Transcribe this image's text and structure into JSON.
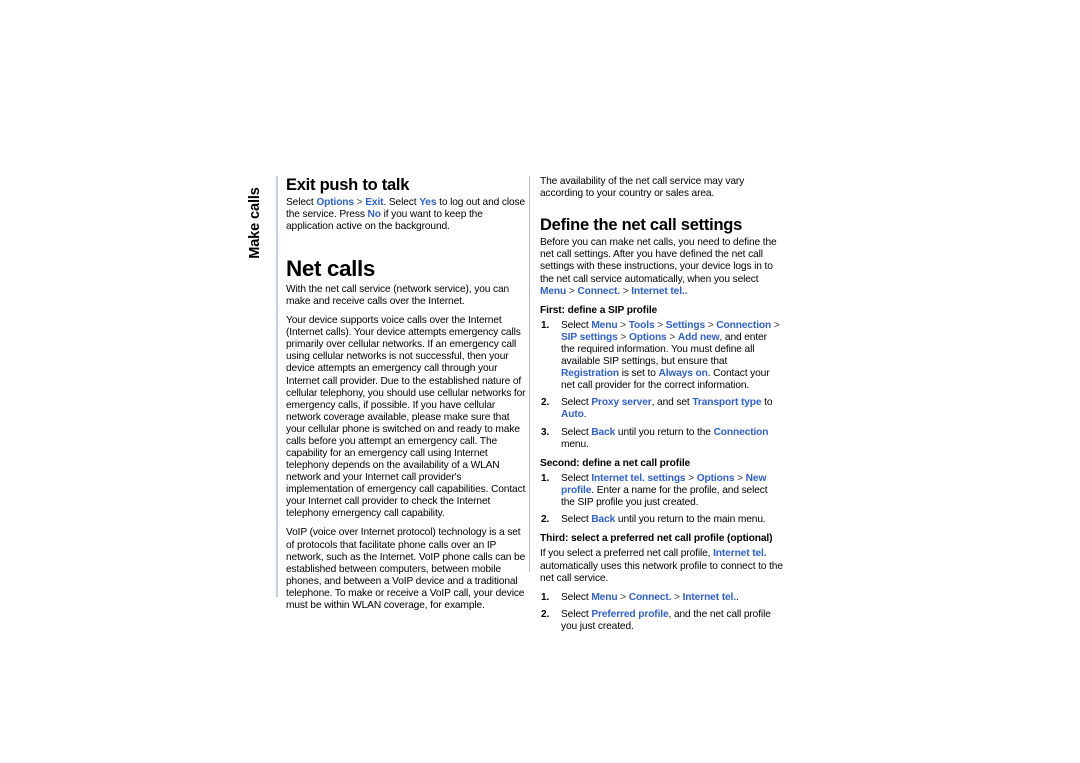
{
  "page": {
    "side_tab_label": "Make calls",
    "link_color": "#2f5fd0",
    "rule_color": "#c3cfe3"
  },
  "left_column": {
    "section_exit": {
      "heading": "Exit push to talk",
      "body_1_a": "Select ",
      "body_1_opt": "Options",
      "body_1_b": " > ",
      "body_1_exit": "Exit",
      "body_1_c": ". Select ",
      "body_1_yes": "Yes",
      "body_1_d": " to log out and close the service. Press ",
      "body_1_no": "No",
      "body_1_e": " if you want to keep the application active on the background."
    },
    "section_net_calls": {
      "heading": "Net calls",
      "para_1": "With the net call service (network service), you can make and receive calls over the Internet.",
      "para_2": "Your device supports voice calls over the Internet (Internet calls). Your device attempts emergency calls primarily over cellular networks. If an emergency call using cellular networks is not successful, then your device attempts an emergency call through your Internet call provider. Due to the established nature of cellular telephony, you should use cellular networks for emergency calls, if possible. If you have cellular network coverage available, please make sure that your cellular phone is switched on and ready to make calls before you attempt an emergency call. The capability for an emergency call using Internet telephony depends on the availability of a WLAN network and your Internet call provider's implementation of emergency call capabilities. Contact your Internet call provider to check the Internet telephony emergency call capability.",
      "para_3": "VoIP (voice over Internet protocol) technology is a set of protocols that facilitate phone calls over an IP network, such as the Internet. VoIP phone calls can be established between computers, between mobile phones, and between a VoIP device and a traditional telephone. To make or receive a VoIP call, your device must be within WLAN coverage, for example."
    }
  },
  "right_column": {
    "intro": "The availability of the net call service may vary according to your country or sales area.",
    "section_define": {
      "heading": "Define the net call settings",
      "para_1_a": "Before you can make net calls, you need to define the net call settings. After you have defined the net call settings with these instructions, your device logs in to the net call service automatically, when you select ",
      "para_1_menu": "Menu",
      "para_1_gt1": " > ",
      "para_1_connect": "Connect.",
      "para_1_gt2": " > ",
      "para_1_inettel": "Internet tel.",
      "para_1_end": ".",
      "sub_first": "First: define a SIP profile",
      "first_items": [
        {
          "num": "1.",
          "seg_a": "Select ",
          "menu": "Menu",
          "gt1": " > ",
          "tools": "Tools",
          "gt2": " > ",
          "settings": "Settings",
          "gt3": " > ",
          "connection": "Connection",
          "gt4": " > ",
          "sipsettings": "SIP settings",
          "gt5": " > ",
          "options": "Options",
          "gt6": " > ",
          "addnew": "Add new",
          "seg_b": ", and enter the required information. You must define all available SIP settings, but ensure that ",
          "registration": "Registration",
          "seg_c": " is set to ",
          "alwayson": "Always on",
          "seg_d": ". Contact your net call provider for the correct information."
        },
        {
          "num": "2.",
          "seg_a": "Select ",
          "proxyserver": "Proxy server",
          "seg_b": ", and set ",
          "transporttype": "Transport type",
          "seg_c": " to ",
          "auto": "Auto",
          "seg_d": "."
        },
        {
          "num": "3.",
          "seg_a": "Select ",
          "back": "Back",
          "seg_b": " until you return to the ",
          "connection": "Connection",
          "seg_c": " menu."
        }
      ],
      "sub_second": "Second: define a net call profile",
      "second_items": [
        {
          "num": "1.",
          "seg_a": "Select ",
          "inettelsettings": "Internet tel. settings",
          "gt1": " > ",
          "options": "Options",
          "gt2": " > ",
          "newprofile": "New profile",
          "seg_b": ". Enter a name for the profile, and select the SIP profile you just created."
        },
        {
          "num": "2.",
          "seg_a": "Select ",
          "back": "Back",
          "seg_b": " until you return to the main menu."
        }
      ],
      "sub_third": "Third: select a preferred net call profile (optional)",
      "third_para_a": "If you select a preferred net call profile, ",
      "third_para_link": "Internet tel.",
      "third_para_b": " automatically uses this network profile to connect to the net call service.",
      "third_items": [
        {
          "num": "1.",
          "seg_a": "Select ",
          "menu": "Menu",
          "gt1": " > ",
          "connect": "Connect.",
          "gt2": " > ",
          "inettel": "Internet tel.",
          "seg_b": "."
        },
        {
          "num": "2.",
          "seg_a": "Select ",
          "preferredprofile": "Preferred profile",
          "seg_b": ", and the net call profile you just created."
        }
      ]
    }
  }
}
